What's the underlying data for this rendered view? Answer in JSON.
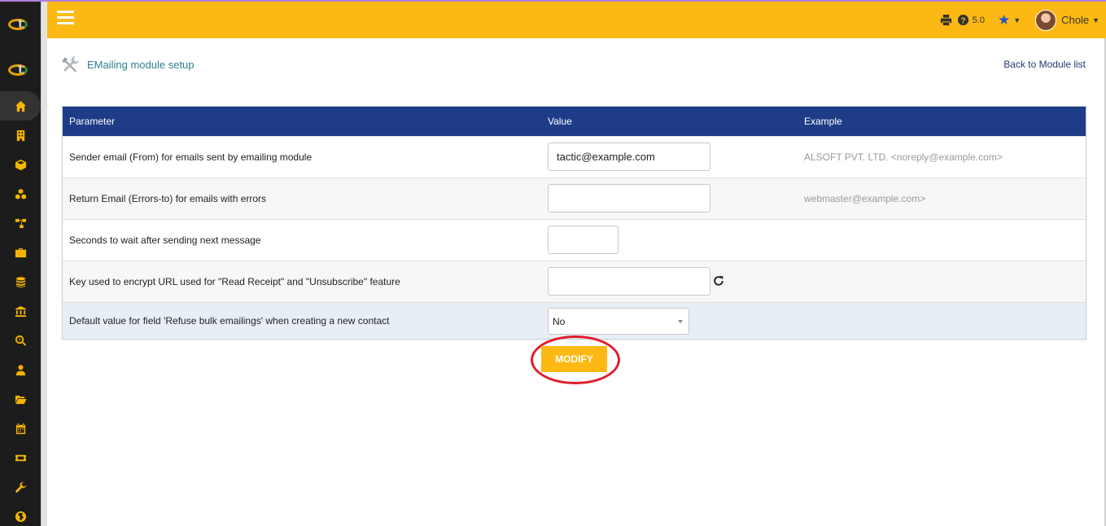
{
  "header": {
    "version": "5.0",
    "username": "Chole"
  },
  "page": {
    "title": "EMailing module setup",
    "back_link": "Back to Module list"
  },
  "table": {
    "headers": [
      "Parameter",
      "Value",
      "Example"
    ],
    "rows": [
      {
        "parameter": "Sender email (From) for emails sent by emailing module",
        "value": "tactic@example.com",
        "example": "ALSOFT PVT. LTD. <noreply@example.com>"
      },
      {
        "parameter": "Return Email (Errors-to) for emails with errors",
        "value": "",
        "example": "webmaster@example.com>"
      },
      {
        "parameter": "Seconds to wait after sending next message",
        "value": "",
        "example": ""
      },
      {
        "parameter": "Key used to encrypt URL used for \"Read Receipt\" and \"Unsubscribe\" feature",
        "value": "",
        "example": ""
      },
      {
        "parameter": "Default value for field 'Refuse bulk emailings' when creating a new contact",
        "value": "No",
        "example": ""
      }
    ]
  },
  "actions": {
    "modify_label": "MODIFY"
  },
  "sidebar": {
    "icons": [
      "home-icon",
      "building-icon",
      "box-icon",
      "cubes-icon",
      "sitemap-icon",
      "briefcase-icon",
      "coins-icon",
      "bank-icon",
      "search-dollar-icon",
      "user-tie-icon",
      "folder-open-icon",
      "calendar-icon",
      "ticket-icon",
      "wrench-icon",
      "globe-icon"
    ]
  },
  "colors": {
    "header": "#fdb913",
    "table_header": "#1e3c87",
    "sidebar": "#1c1c1c",
    "accent_icon": "#f7b500",
    "highlight_circle": "#e01e2a"
  }
}
